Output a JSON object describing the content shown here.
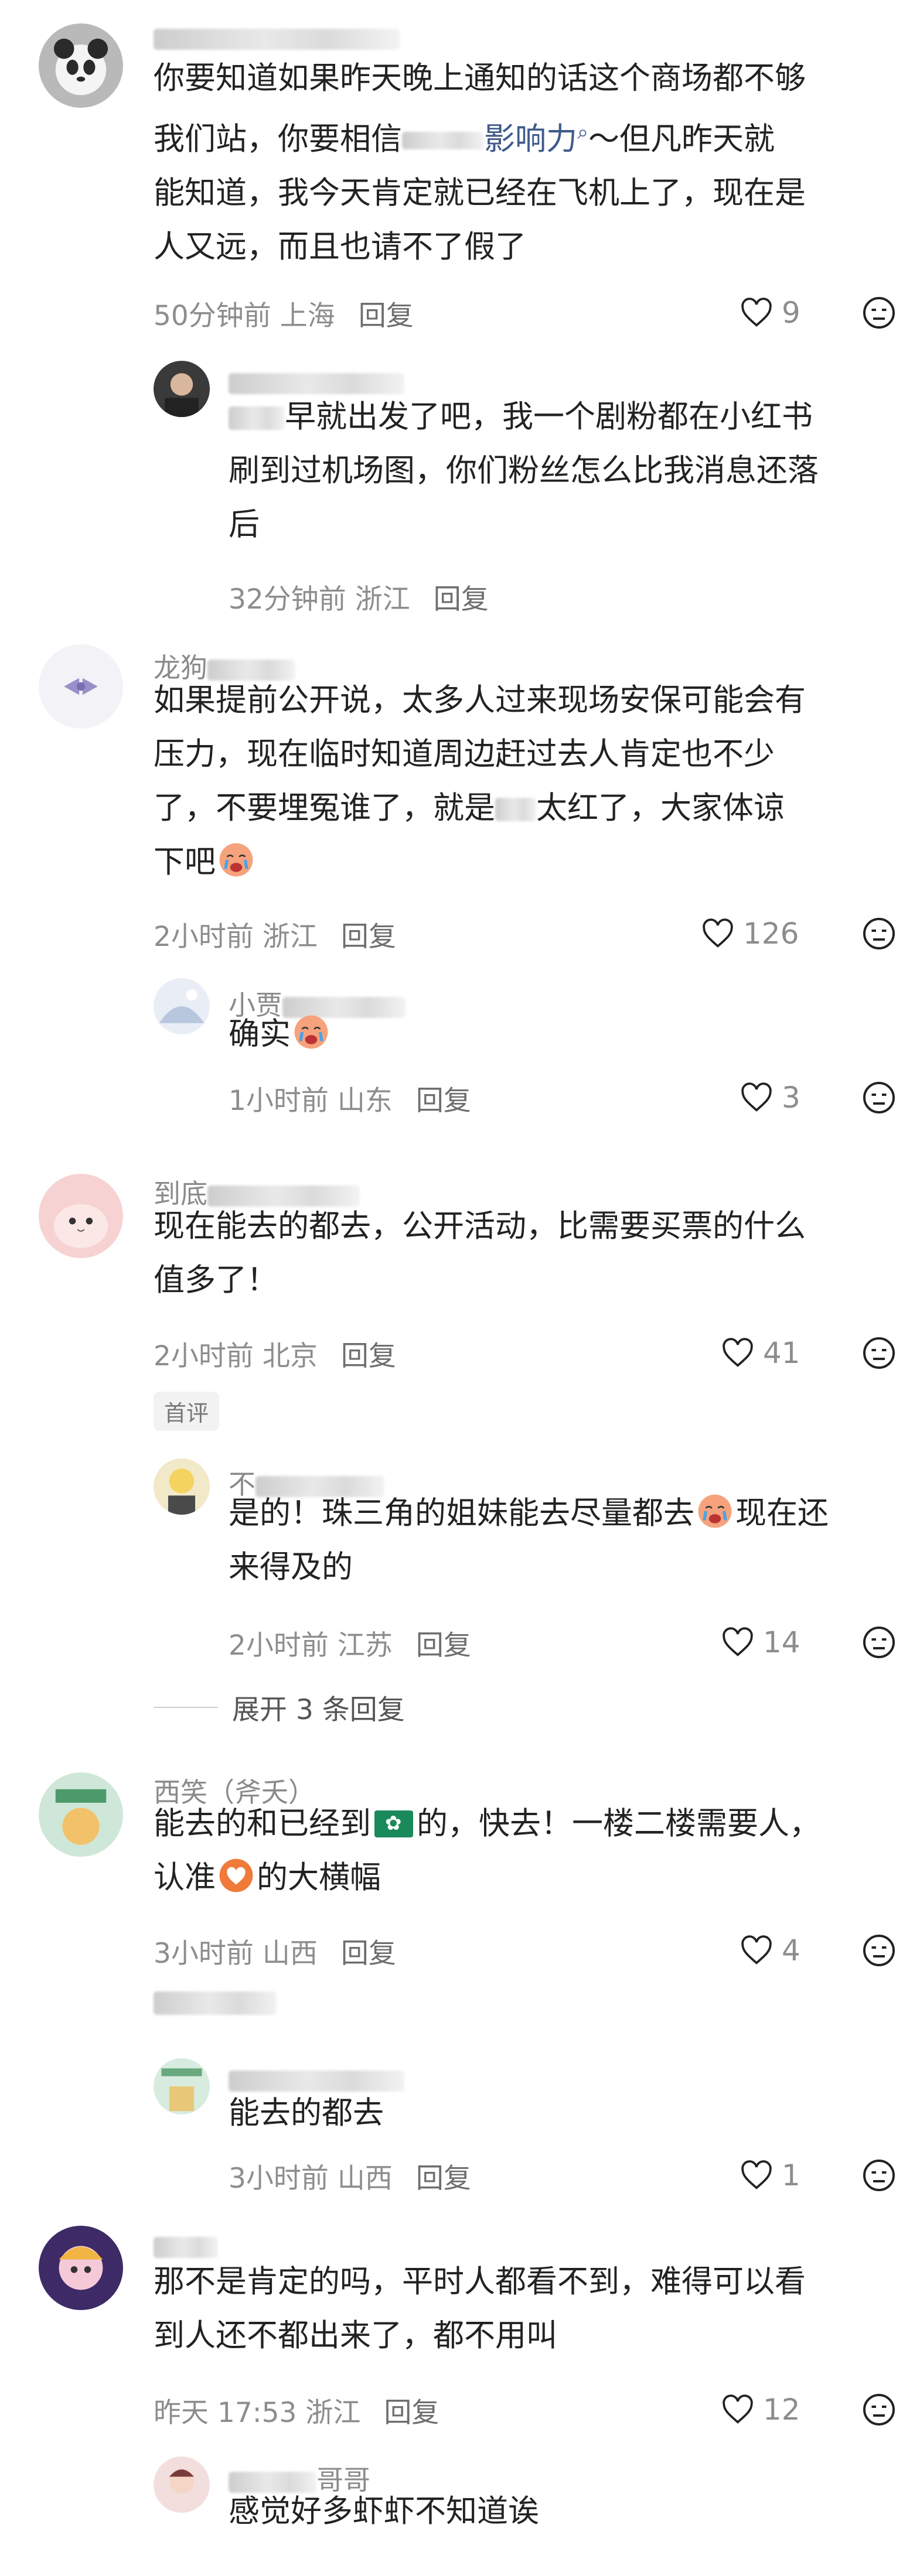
{
  "ui": {
    "reply_label": "回复",
    "first_review_badge": "首评"
  },
  "comments": [
    {
      "name": "倩芊桐呈竹",
      "lines": [
        "你要知道如果昨天晚上通知的话这个商场都不够",
        "我们站，你要相信",
        "影响力",
        "～但凡昨天就",
        "能知道，我今天肯定就已经在飞机上了，现在是",
        "人又远，而且也请不了假了"
      ],
      "time": "50分钟前",
      "location": "上海",
      "likes": "9"
    },
    {
      "name": "",
      "lines": [
        "早就出发了吧，我一个剧粉都在小红书",
        "刷到过机场图，你们粉丝怎么比我消息还落",
        "后"
      ],
      "time": "32分钟前",
      "location": "浙江"
    },
    {
      "name": "龙狗",
      "lines": [
        "如果提前公开说，太多人过来现场安保可能会有",
        "压力，现在临时知道周边赶过去人肯定也不少",
        "了，不要埋冤谁了，就是",
        "太红了，大家体谅",
        "下吧"
      ],
      "time": "2小时前",
      "location": "浙江",
      "likes": "126"
    },
    {
      "name": "小贾",
      "lines": [
        "确实"
      ],
      "time": "1小时前",
      "location": "山东",
      "likes": "3"
    },
    {
      "name": "到底",
      "lines": [
        "现在能去的都去，公开活动，比需要买票的什么",
        "值多了！"
      ],
      "time": "2小时前",
      "location": "北京",
      "likes": "41"
    },
    {
      "name": "不",
      "lines": [
        "是的！珠三角的姐妹能去尽量都去",
        "现在还",
        "来得及的"
      ],
      "time": "2小时前",
      "location": "江苏",
      "likes": "14",
      "expand": "展开 3 条回复"
    },
    {
      "name": "西笑（斧夭）",
      "lines": [
        "能去的和已经到",
        "的，快去！一楼二楼需要人，",
        "认准",
        "的大横幅"
      ],
      "time": "3小时前",
      "location": "山西",
      "likes": "4"
    },
    {
      "name": "",
      "lines": [
        "能去的都去"
      ],
      "time": "3小时前",
      "location": "山西",
      "likes": "1"
    },
    {
      "name": "",
      "lines": [
        "那不是肯定的吗，平时人都看不到，难得可以看",
        "到人还不都出来了，都不用叫"
      ],
      "time": "昨天 17:53",
      "location": "浙江",
      "likes": "12"
    },
    {
      "name": "哥哥",
      "lines": [
        "感觉好多虾虾不知道诶"
      ],
      "time": "",
      "location": ""
    }
  ]
}
